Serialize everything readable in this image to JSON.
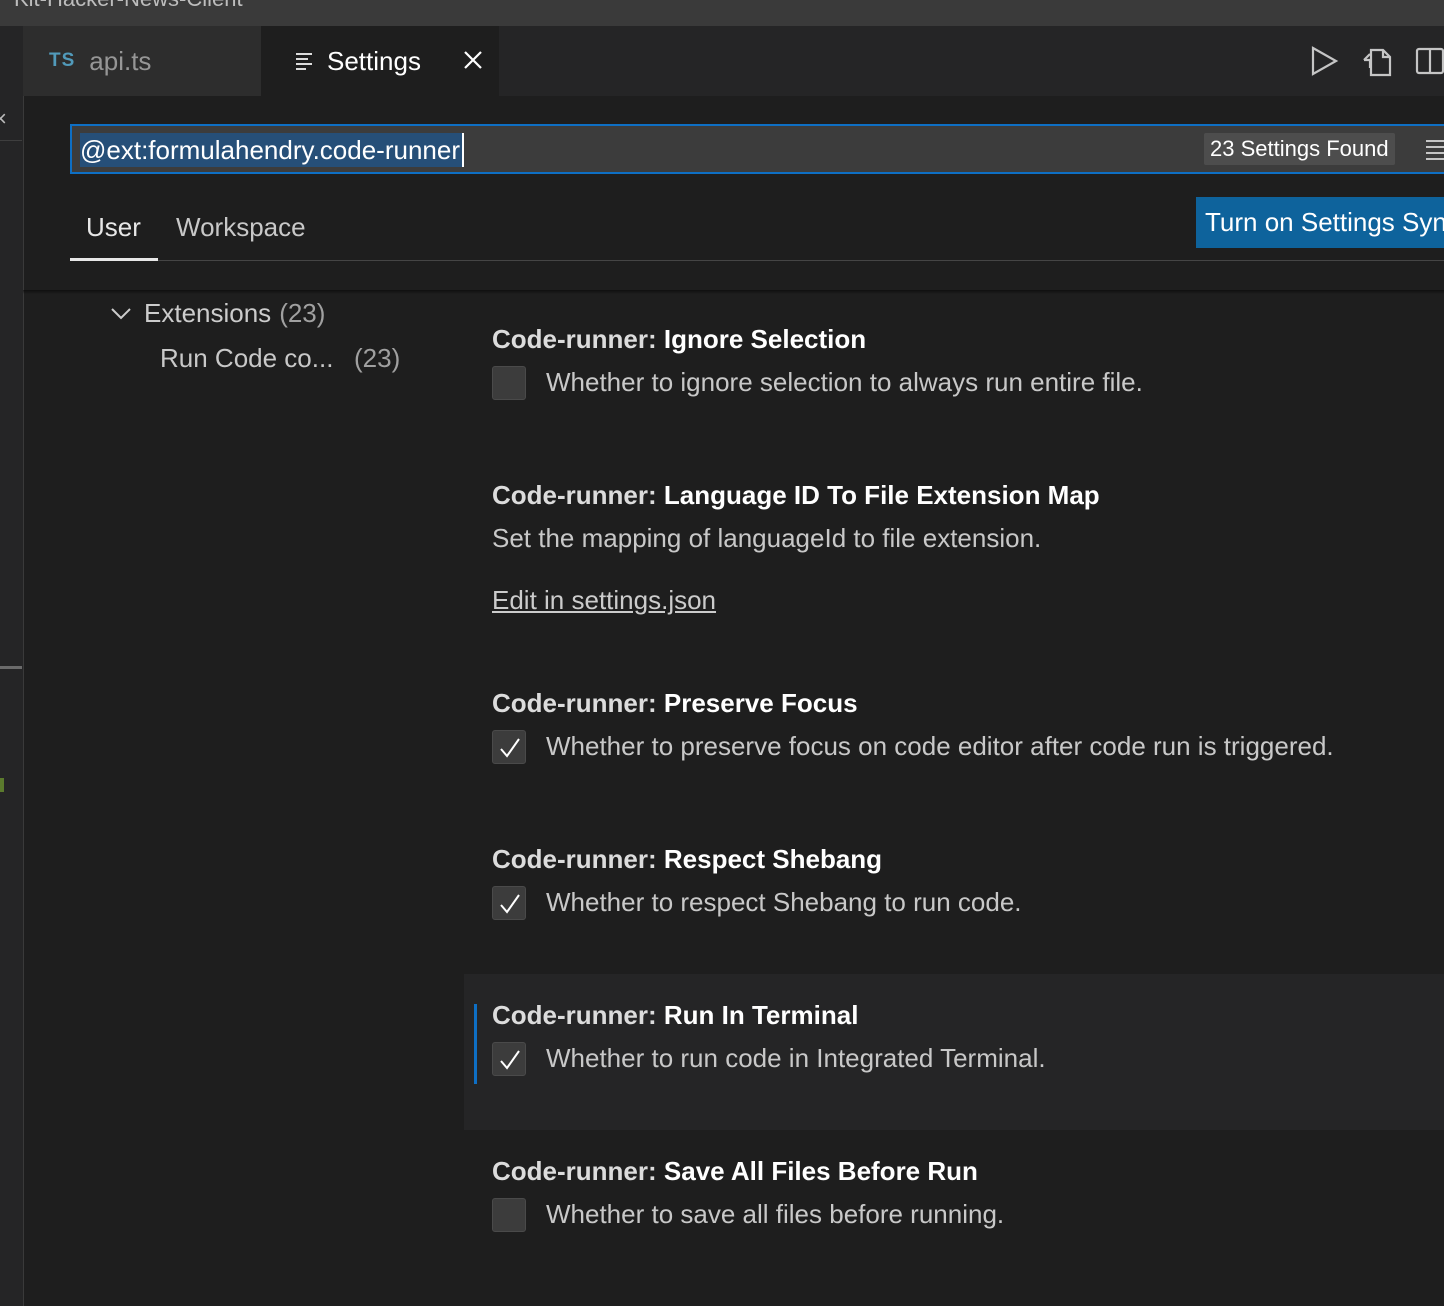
{
  "window": {
    "title": "Kit-Hacker-News-Client"
  },
  "tabs": [
    {
      "badge": "TS",
      "label": "api.ts"
    },
    {
      "label": "Settings"
    }
  ],
  "search": {
    "value": "@ext:formulahendry.code-runner",
    "results_badge": "23 Settings Found"
  },
  "scopes": {
    "user": "User",
    "workspace": "Workspace"
  },
  "sync_button": "Turn on Settings Sync",
  "toc": {
    "extensions_label": "Extensions",
    "extensions_count": "(23)",
    "group_label": "Run Code co...",
    "group_count": "(23)"
  },
  "settings": [
    {
      "category": "Code-runner: ",
      "name": "Ignore Selection",
      "description": "Whether to ignore selection to always run entire file.",
      "checked": false
    },
    {
      "category": "Code-runner: ",
      "name": "Language ID To File Extension Map",
      "description": "Set the mapping of languageId to file extension.",
      "link": "Edit in settings.json"
    },
    {
      "category": "Code-runner: ",
      "name": "Preserve Focus",
      "description": "Whether to preserve focus on code editor after code run is triggered.",
      "checked": true
    },
    {
      "category": "Code-runner: ",
      "name": "Respect Shebang",
      "description": "Whether to respect Shebang to run code.",
      "checked": true
    },
    {
      "category": "Code-runner: ",
      "name": "Run In Terminal",
      "description": "Whether to run code in Integrated Terminal.",
      "checked": true
    },
    {
      "category": "Code-runner: ",
      "name": "Save All Files Before Run",
      "description": "Whether to save all files before running.",
      "checked": false
    }
  ],
  "colors": {
    "accent": "#0e639c",
    "focus": "#0e6fc4",
    "background": "#1e1e1e",
    "ts_badge": "#519aba"
  }
}
